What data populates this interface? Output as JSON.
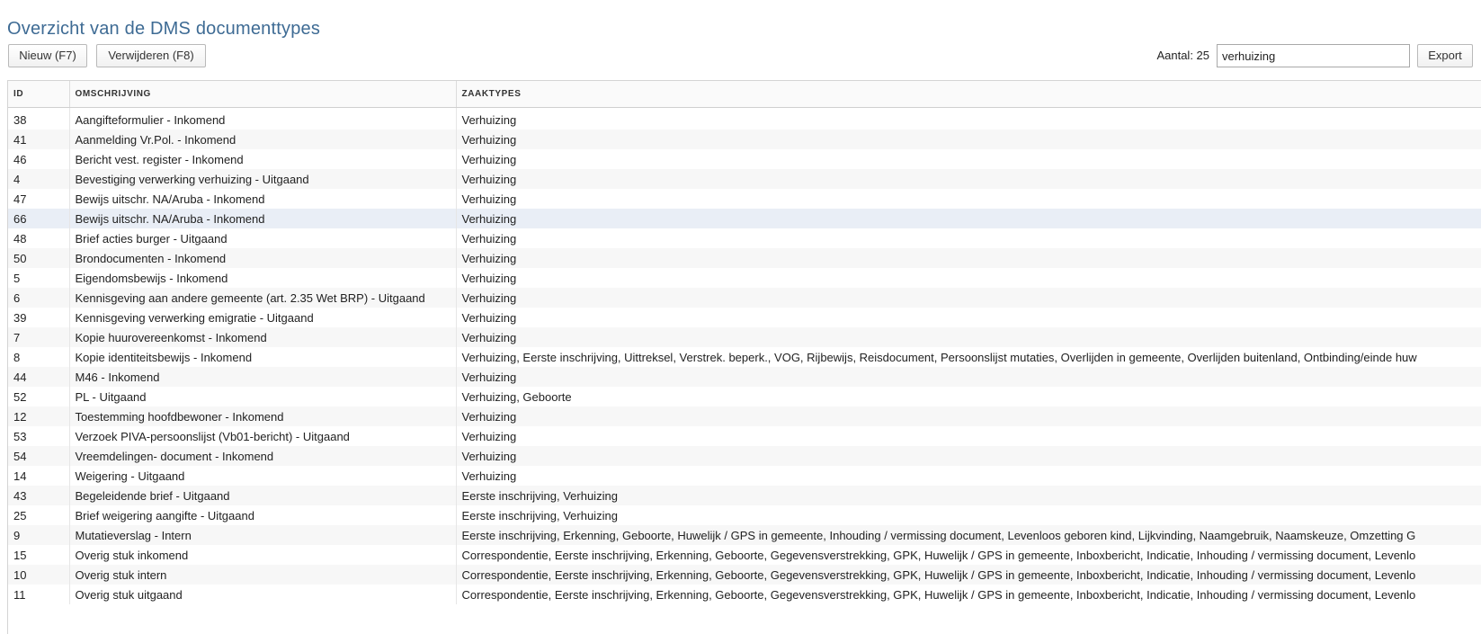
{
  "page": {
    "title": "Overzicht van de DMS documenttypes"
  },
  "toolbar": {
    "new_label": "Nieuw (F7)",
    "delete_label": "Verwijderen (F8)",
    "count_label": "Aantal: 25",
    "search_value": "verhuizing",
    "export_label": "Export"
  },
  "table": {
    "columns": [
      "ID",
      "OMSCHRIJVING",
      "ZAAKTYPES"
    ],
    "selected_row_id": "66",
    "rows": [
      {
        "id": "38",
        "omschrijving": "Aangifteformulier - Inkomend",
        "zaaktypes": "Verhuizing"
      },
      {
        "id": "41",
        "omschrijving": "Aanmelding Vr.Pol. - Inkomend",
        "zaaktypes": "Verhuizing"
      },
      {
        "id": "46",
        "omschrijving": "Bericht vest. register - Inkomend",
        "zaaktypes": "Verhuizing"
      },
      {
        "id": "4",
        "omschrijving": "Bevestiging verwerking verhuizing - Uitgaand",
        "zaaktypes": "Verhuizing"
      },
      {
        "id": "47",
        "omschrijving": "Bewijs uitschr. NA/Aruba - Inkomend",
        "zaaktypes": "Verhuizing"
      },
      {
        "id": "66",
        "omschrijving": "Bewijs uitschr. NA/Aruba - Inkomend",
        "zaaktypes": "Verhuizing"
      },
      {
        "id": "48",
        "omschrijving": "Brief acties burger - Uitgaand",
        "zaaktypes": "Verhuizing"
      },
      {
        "id": "50",
        "omschrijving": "Brondocumenten - Inkomend",
        "zaaktypes": "Verhuizing"
      },
      {
        "id": "5",
        "omschrijving": "Eigendomsbewijs - Inkomend",
        "zaaktypes": "Verhuizing"
      },
      {
        "id": "6",
        "omschrijving": "Kennisgeving aan andere gemeente (art. 2.35 Wet BRP) - Uitgaand",
        "zaaktypes": "Verhuizing"
      },
      {
        "id": "39",
        "omschrijving": "Kennisgeving verwerking emigratie - Uitgaand",
        "zaaktypes": "Verhuizing"
      },
      {
        "id": "7",
        "omschrijving": "Kopie huurovereenkomst - Inkomend",
        "zaaktypes": "Verhuizing"
      },
      {
        "id": "8",
        "omschrijving": "Kopie identiteitsbewijs - Inkomend",
        "zaaktypes": "Verhuizing, Eerste inschrijving, Uittreksel, Verstrek. beperk., VOG, Rijbewijs, Reisdocument, Persoonslijst mutaties, Overlijden in gemeente, Overlijden buitenland, Ontbinding/einde huw"
      },
      {
        "id": "44",
        "omschrijving": "M46 - Inkomend",
        "zaaktypes": "Verhuizing"
      },
      {
        "id": "52",
        "omschrijving": "PL - Uitgaand",
        "zaaktypes": "Verhuizing, Geboorte"
      },
      {
        "id": "12",
        "omschrijving": "Toestemming hoofdbewoner - Inkomend",
        "zaaktypes": "Verhuizing"
      },
      {
        "id": "53",
        "omschrijving": "Verzoek PIVA-persoonslijst (Vb01-bericht) - Uitgaand",
        "zaaktypes": "Verhuizing"
      },
      {
        "id": "54",
        "omschrijving": "Vreemdelingen- document - Inkomend",
        "zaaktypes": "Verhuizing"
      },
      {
        "id": "14",
        "omschrijving": "Weigering - Uitgaand",
        "zaaktypes": "Verhuizing"
      },
      {
        "id": "43",
        "omschrijving": "Begeleidende brief - Uitgaand",
        "zaaktypes": "Eerste inschrijving, Verhuizing"
      },
      {
        "id": "25",
        "omschrijving": "Brief weigering aangifte - Uitgaand",
        "zaaktypes": "Eerste inschrijving, Verhuizing"
      },
      {
        "id": "9",
        "omschrijving": "Mutatieverslag - Intern",
        "zaaktypes": "Eerste inschrijving, Erkenning, Geboorte, Huwelijk / GPS in gemeente, Inhouding / vermissing document, Levenloos geboren kind, Lijkvinding, Naamgebruik, Naamskeuze, Omzetting G"
      },
      {
        "id": "15",
        "omschrijving": "Overig stuk inkomend",
        "zaaktypes": "Correspondentie, Eerste inschrijving, Erkenning, Geboorte, Gegevensverstrekking, GPK, Huwelijk / GPS in gemeente, Inboxbericht, Indicatie, Inhouding / vermissing document, Levenlo"
      },
      {
        "id": "10",
        "omschrijving": "Overig stuk intern",
        "zaaktypes": "Correspondentie, Eerste inschrijving, Erkenning, Geboorte, Gegevensverstrekking, GPK, Huwelijk / GPS in gemeente, Inboxbericht, Indicatie, Inhouding / vermissing document, Levenlo"
      },
      {
        "id": "11",
        "omschrijving": "Overig stuk uitgaand",
        "zaaktypes": "Correspondentie, Eerste inschrijving, Erkenning, Geboorte, Gegevensverstrekking, GPK, Huwelijk / GPS in gemeente, Inboxbericht, Indicatie, Inhouding / vermissing document, Levenlo"
      }
    ]
  }
}
